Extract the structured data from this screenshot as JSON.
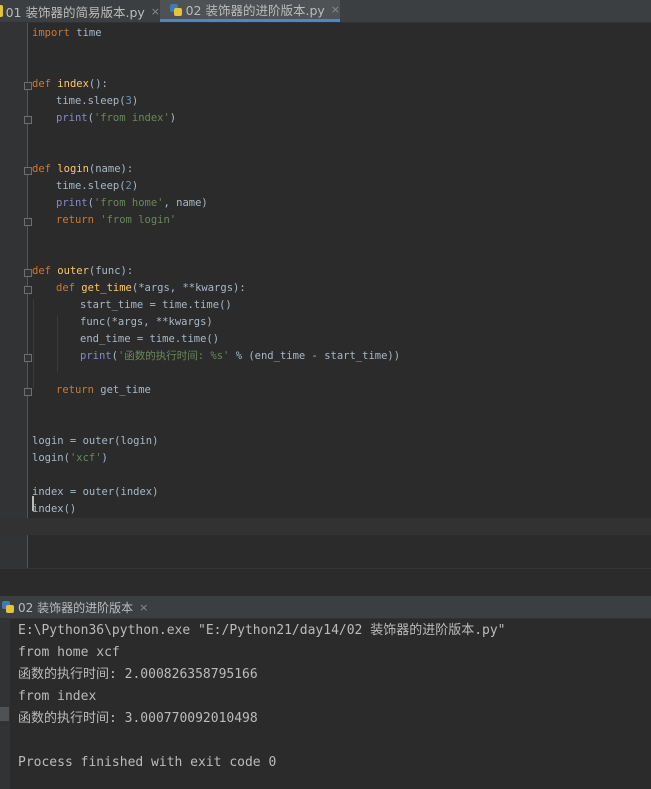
{
  "tabs": [
    {
      "label": "01 装饰器的简易版本.py",
      "close": "×"
    },
    {
      "label": "02 装饰器的进阶版本.py",
      "close": "×"
    }
  ],
  "code": {
    "l1_kw": "import",
    "l1_rest": " time",
    "l2_kw": "def",
    "l2_fn": "index",
    "l2_rest": "():",
    "l3_a": "time.sleep(",
    "l3_n": "3",
    "l3_b": ")",
    "l4_bi": "print",
    "l4_a": "(",
    "l4_s": "'from index'",
    "l4_b": ")",
    "l5_kw": "def",
    "l5_fn": "login",
    "l5_rest": "(name):",
    "l6_a": "time.sleep(",
    "l6_n": "2",
    "l6_b": ")",
    "l7_bi": "print",
    "l7_a": "(",
    "l7_s": "'from home'",
    "l7_b": ", name)",
    "l8_kw": "return",
    "l8_s": " 'from login'",
    "l9_kw": "def",
    "l9_fn": "outer",
    "l9_rest": "(func):",
    "l10_kw": "def",
    "l10_fn": "get_time",
    "l10_rest": "(*args, **kwargs):",
    "l11": "start_time = time.time()",
    "l12": "func(*args, **kwargs)",
    "l13": "end_time = time.time()",
    "l14_bi": "print",
    "l14_a": "(",
    "l14_s": "'函数的执行时间: %s'",
    "l14_b": " % (end_time - start_time))",
    "l15_kw": "return",
    "l15_rest": " get_time",
    "l16": "login = outer(login)",
    "l17_a": "login(",
    "l17_s": "'xcf'",
    "l17_b": ")",
    "l18": "index = outer(index)",
    "l19": "index()"
  },
  "run": {
    "tab_label": "02 装饰器的进阶版本",
    "close": "×",
    "output": [
      "E:\\Python36\\python.exe \"E:/Python21/day14/02 装饰器的进阶版本.py\"",
      "from home xcf",
      "函数的执行时间: 2.000826358795166",
      "from index",
      "函数的执行时间: 3.000770092010498",
      "",
      "Process finished with exit code 0"
    ]
  },
  "colors": {
    "keyword": "#cc7832",
    "function": "#ffc66d",
    "string": "#6a8759",
    "number": "#6897bb",
    "builtin": "#8888c6",
    "text": "#a9b7c6",
    "accent": "#4a88c7"
  }
}
